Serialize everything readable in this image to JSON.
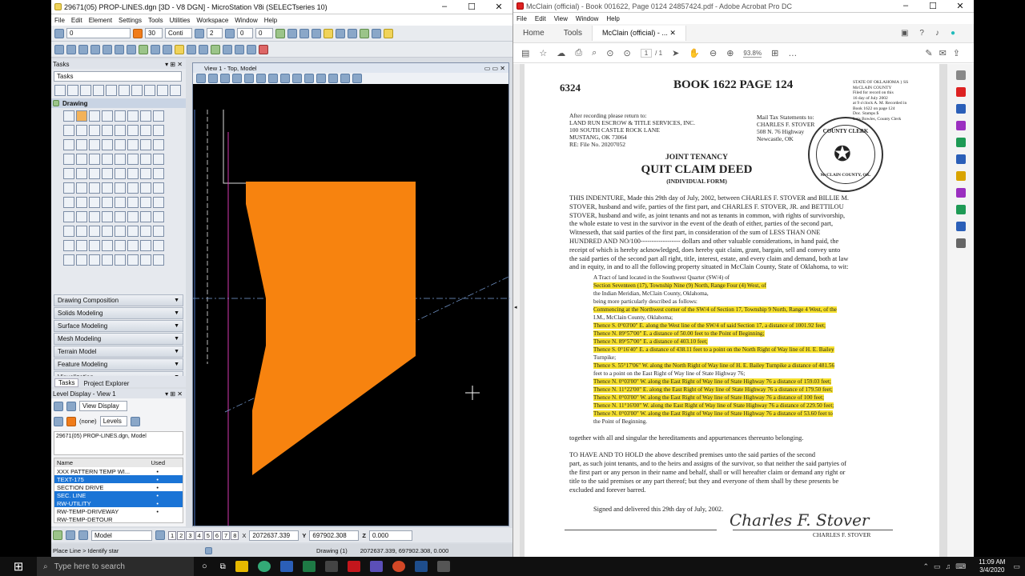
{
  "microstation": {
    "title": "29671(05) PROP-LINES.dgn [3D - V8 DGN] - MicroStation V8i (SELECTseries 10)",
    "menu": [
      "File",
      "Edit",
      "Element",
      "Settings",
      "Tools",
      "Utilities",
      "Workspace",
      "Window",
      "Help"
    ],
    "attributes": {
      "level": "0",
      "color": "30",
      "line_style": "Conti",
      "weight": "2",
      "class": "0",
      "transparency": "0"
    },
    "tasks_title": "Tasks",
    "tasks_combo": "Tasks",
    "drawing_label": "Drawing",
    "sections": [
      "Drawing Composition",
      "Solids Modeling",
      "Surface Modeling",
      "Mesh Modeling",
      "Terrain Model",
      "Feature Modeling",
      "Visualization"
    ],
    "tabs": [
      "Tasks",
      "Project Explorer"
    ],
    "level_display_title": "Level Display - View 1",
    "view_display": "View Display",
    "none_label": "(none)",
    "levels_label": "Levels",
    "model_tree": "29671(05) PROP-LINES.dgn, Model",
    "levels_header": {
      "name": "Name",
      "used": "Used"
    },
    "levels": [
      {
        "name": "XXX PATTERN TEMP WI...",
        "used": "•",
        "selected": false
      },
      {
        "name": "TEXT-175",
        "used": "•",
        "selected": true
      },
      {
        "name": "SECTION DRIVE",
        "used": "•",
        "selected": false
      },
      {
        "name": "SEC. LINE",
        "used": "•",
        "selected": true
      },
      {
        "name": "RW-UTILITY",
        "used": "•",
        "selected": true
      },
      {
        "name": "RW-TEMP-DRIVEWAY",
        "used": "•",
        "selected": false
      },
      {
        "name": "RW-TEMP-DETOUR",
        "used": "",
        "selected": false
      }
    ],
    "view_title": "View 1 - Top, Model",
    "model_combo": "Model",
    "view_numbers": [
      "1",
      "2",
      "3",
      "4",
      "5",
      "6",
      "7",
      "8"
    ],
    "coords": {
      "x_label": "X",
      "x": "2072637.339",
      "y_label": "Y",
      "y": "697902.308",
      "z_label": "Z",
      "z": "0.000"
    },
    "status_left": "Place Line > Identify star",
    "status_mode": "Drawing (1)",
    "status_xy": "2072637.339, 697902.308, 0.000",
    "shape_color": "#f7830f"
  },
  "acrobat": {
    "title": "McClain (official) - Book 001622, Page 0124 24857424.pdf - Adobe Acrobat Pro DC",
    "menu": [
      "File",
      "Edit",
      "View",
      "Window",
      "Help"
    ],
    "tabs": [
      "Home",
      "Tools",
      "McClain (official) - ..."
    ],
    "page_current": "1",
    "page_total": "/ 1",
    "zoom": "93.8%",
    "highlight_color": "#f7e12d",
    "doc": {
      "number": "6324",
      "book": "BOOK 1622 PAGE 124",
      "state_stamp": "STATE OF OKLAHOMA } SS\nMcCLAIN COUNTY\nFiled for record on this\n16 day of July 2002\nat 9 o'clock A. M. Recorded in\nBook 1622 on page 124\nDoc. Stamps $\nLois Bowles, County Clerk",
      "return_to": "After recording please return to:\nLAND RUN ESCROW & TITLE SERVICES, INC.\n100 SOUTH CASTLE ROCK LANE\nMUSTANG, OK 73064\nRE: File No. 20207052",
      "mail_tax": "Mail Tax Statements to:\nCHARLES F. STOVER\n508 N. 76 Highway\nNewcastle, OK",
      "seal_top": "COUNTY CLERK",
      "seal_bottom": "McCLAIN COUNTY, OK.",
      "heading1": "JOINT TENANCY",
      "heading2": "QUIT CLAIM DEED",
      "heading3": "(INDIVIDUAL FORM)",
      "body": [
        "THIS INDENTURE, Made this 29th day of July, 2002,  between CHARLES F. STOVER and BILLIE M.",
        "STOVER, husband and wife, parties of the first part, and CHARLES F. STOVER, JR. and BETTILOU",
        "STOVER, husband and wife, as joint tenants and not as tenants in common, with rights of survivorship,",
        "the whole estate to vest in the survivor in the event of the death of either, parties of the second part,",
        "Witnesseth, that said parties of the first part, in consideration of the sum of LESS THAN ONE",
        "HUNDRED AND NO/100------------------ dollars and other valuable considerations, in hand paid, the",
        "receipt of which is hereby acknowledged, does hereby quit claim, grant, bargain, sell and convey unto",
        "the said parties of the second part all right, title, interest, estate, and every claim and demand, both at law",
        "and in equity, in and to all the following property situated in McClain County, State of Oklahoma, to wit:"
      ],
      "legal": [
        {
          "text": "A Tract of land located in the Southwest Quarter (SW/4) of",
          "hl": false,
          "indent": 30
        },
        {
          "text": "Section Seventeen (17), Township Nine (9) North, Range Four (4) West, of",
          "hl": true,
          "indent": 30
        },
        {
          "text": "the Indian Meridian, McClain County, Oklahoma,",
          "hl": false,
          "indent": 30
        },
        {
          "text": "being more particularly described as follows:",
          "hl": false,
          "indent": 30
        },
        {
          "text": "Commencing at the Northwest corner of the SW/4 of Section 17, Township 9 North, Range 4 West, of the",
          "hl": true,
          "indent": 30
        },
        {
          "text": "I.M., McClain County, Oklahoma;",
          "hl": false,
          "indent": 30
        },
        {
          "text": "Thence S. 0°03'00\" E. along the West line of the SW/4 of said Section 17, a distance of 1001.92 feet;",
          "hl": true,
          "indent": 30
        },
        {
          "text": "Thence N. 89°57'00\" E. a distance of 50.00 feet to the Point of Beginning;",
          "hl": true,
          "indent": 30
        },
        {
          "text": "Thence N. 89°57'00\" E. a distance of 403.10 feet;",
          "hl": true,
          "indent": 30
        },
        {
          "text": "Thence S. 0°16'40\" E. a distance of 438.11 feet to a point on the North Right of Way line of H. E. Bailey",
          "hl": true,
          "indent": 30
        },
        {
          "text": "Turnpike;",
          "hl": false,
          "indent": 30
        },
        {
          "text": "Thence S. 55°17'06\" W. along the North Right of Way line of H. E. Bailey Turnpike a distance of 481.56",
          "hl": true,
          "indent": 30
        },
        {
          "text": "feet to a point on the East Right of Way line of State Highway 76;",
          "hl": false,
          "indent": 30
        },
        {
          "text": "Thence N. 0°03'00\" W. along the East Right of Way line of State Highway 76 a distance of 159.03 feet;",
          "hl": true,
          "indent": 30
        },
        {
          "text": "Thence N. 11°22'00\" E. along the East Right of Way line of State Highway 76 a distance of 179.50 feet;",
          "hl": true,
          "indent": 30
        },
        {
          "text": "Thence N. 0°03'00\" W. along the East Right of Way line of State Highway 76 a distance of 100 feet;",
          "hl": true,
          "indent": 30
        },
        {
          "text": "Thence N. 11°16'00\" W. along the East Right of Way line of State Highway 76 a distance of 229.50 feet;",
          "hl": true,
          "indent": 30
        },
        {
          "text": "Thence N. 0°03'00\" W. along the East Right of Way line of State Highway 76 a distance of 53.60 feet to",
          "hl": true,
          "indent": 30
        },
        {
          "text": "the Point of Beginning.",
          "hl": false,
          "indent": 30
        }
      ],
      "together": "together with all and singular the hereditaments and appurtenances thereunto belonging.",
      "tohold": [
        "TO HAVE AND TO HOLD the above described premises unto the said parties of the second",
        "part, as such joint tenants, and to the heirs and assigns of the survivor, so that neither the said partyies of",
        "the first part or any person in their name and behalf, shall or will hereafter claim or demand any right or",
        "title to the said premises or any part thereof; but they and everyone of them shall by these presents be",
        "excluded and forever barred."
      ],
      "signed": "Signed and delivered this 29th day of July, 2002.",
      "signer": "CHARLES F. STOVER"
    }
  },
  "taskbar": {
    "search_placeholder": "Type here to search",
    "time": "11:09 AM",
    "date": "3/4/2020"
  }
}
